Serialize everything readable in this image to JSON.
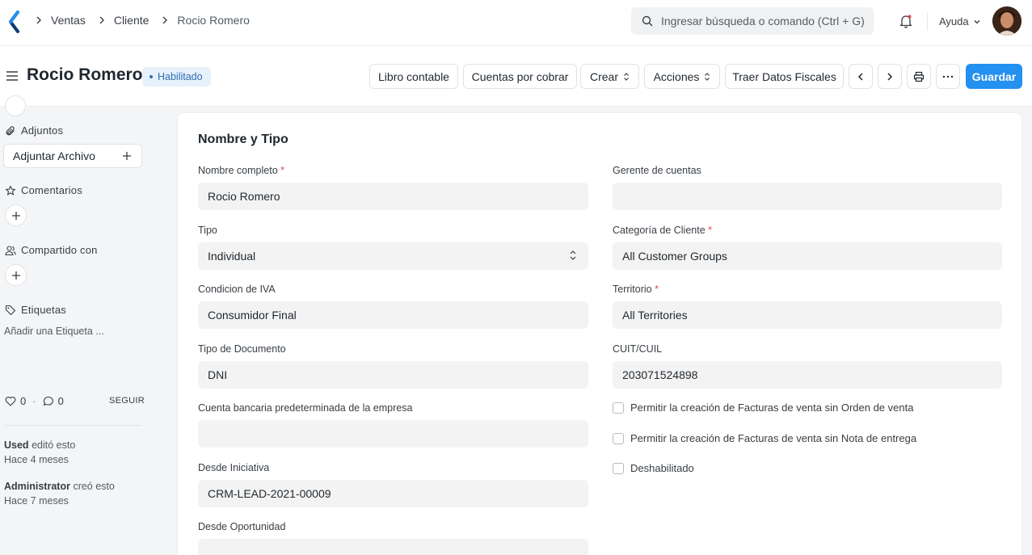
{
  "nav": {
    "breadcrumb": [
      "Ventas",
      "Cliente",
      "Rocio Romero"
    ],
    "search_placeholder": "Ingresar búsqueda o comando (Ctrl + G)",
    "help_label": "Ayuda"
  },
  "header": {
    "title": "Rocio Romero",
    "status": "Habilitado",
    "buttons": {
      "ledger": "Libro contable",
      "receivables": "Cuentas por cobrar",
      "create": "Crear",
      "actions": "Acciones",
      "fiscal": "Traer Datos Fiscales",
      "save": "Guardar"
    }
  },
  "sidebar": {
    "attachments_label": "Adjuntos",
    "attach_button": "Adjuntar Archivo",
    "comments_label": "Comentarios",
    "shared_label": "Compartido con",
    "tags_label": "Etiquetas",
    "add_tag": "Añadir una Etiqueta ...",
    "likes": "0",
    "comments_count": "0",
    "follow": "SEGUIR",
    "activity": [
      {
        "user": "Used",
        "action": "editó esto",
        "when": "Hace 4 meses"
      },
      {
        "user": "Administrator",
        "action": "creó esto",
        "when": "Hace 7 meses"
      }
    ]
  },
  "form": {
    "section_title": "Nombre y Tipo",
    "full_name": {
      "label": "Nombre completo",
      "value": "Rocio Romero"
    },
    "type": {
      "label": "Tipo",
      "value": "Individual"
    },
    "vat_condition": {
      "label": "Condicion de IVA",
      "value": "Consumidor Final"
    },
    "doc_type": {
      "label": "Tipo de Documento",
      "value": "DNI"
    },
    "bank_account": {
      "label": "Cuenta bancaria predeterminada de la empresa",
      "value": ""
    },
    "from_lead": {
      "label": "Desde Iniciativa",
      "value": "CRM-LEAD-2021-00009"
    },
    "from_opportunity": {
      "label": "Desde Oportunidad",
      "value": ""
    },
    "account_manager": {
      "label": "Gerente de cuentas",
      "value": ""
    },
    "customer_group": {
      "label": "Categoría de Cliente",
      "value": "All Customer Groups"
    },
    "territory": {
      "label": "Territorio",
      "value": "All Territories"
    },
    "tax_id": {
      "label": "CUIT/CUIL",
      "value": "203071524898"
    },
    "checks": [
      "Permitir la creación de Facturas de venta sin Orden de venta",
      "Permitir la creación de Facturas de venta sin Nota de entrega",
      "Deshabilitado"
    ],
    "required_mark": "*"
  }
}
